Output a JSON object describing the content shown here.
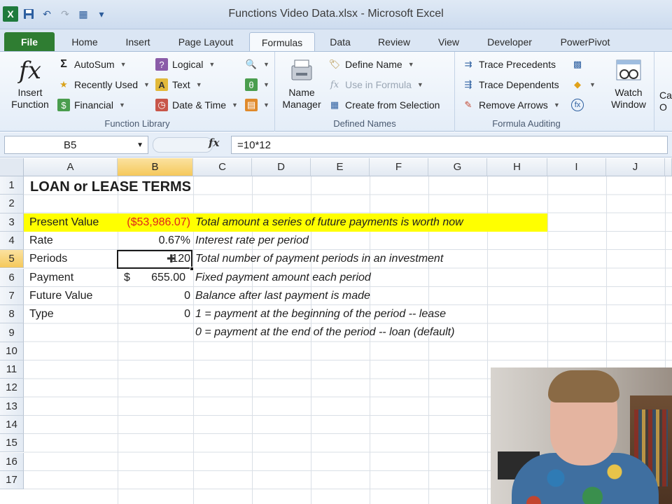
{
  "window": {
    "title": "Functions Video Data.xlsx - Microsoft Excel"
  },
  "quick_access": [
    {
      "icon": "excel-logo-icon",
      "glyph": "X"
    },
    {
      "icon": "save-icon",
      "glyph": "💾"
    },
    {
      "icon": "undo-icon",
      "glyph": "↶"
    },
    {
      "icon": "redo-icon",
      "glyph": "↷"
    },
    {
      "icon": "form-icon",
      "glyph": "▦"
    },
    {
      "icon": "customize-qat-icon",
      "glyph": "▾"
    }
  ],
  "tabs": [
    "File",
    "Home",
    "Insert",
    "Page Layout",
    "Formulas",
    "Data",
    "Review",
    "View",
    "Developer",
    "PowerPivot"
  ],
  "active_tab": "Formulas",
  "ribbon": {
    "function_library": {
      "label": "Function Library",
      "insert_function": {
        "line1": "Insert",
        "line2": "Function"
      },
      "autosum": "AutoSum",
      "recently_used": "Recently Used",
      "financial": "Financial",
      "logical": "Logical",
      "text": "Text",
      "date_time": "Date & Time"
    },
    "defined_names": {
      "label": "Defined Names",
      "name_manager": {
        "line1": "Name",
        "line2": "Manager"
      },
      "define_name": "Define Name",
      "use_in_formula": "Use in Formula",
      "create_from_selection": "Create from Selection"
    },
    "formula_auditing": {
      "label": "Formula Auditing",
      "trace_precedents": "Trace Precedents",
      "trace_dependents": "Trace Dependents",
      "remove_arrows": "Remove Arrows",
      "watch_window": {
        "line1": "Watch",
        "line2": "Window"
      },
      "calc_partial": {
        "line1": "Ca",
        "line2": "O"
      }
    }
  },
  "formula_bar": {
    "name_box": "B5",
    "fx": "fx",
    "formula": "=10*12"
  },
  "columns": [
    "A",
    "B",
    "C",
    "D",
    "E",
    "F",
    "G",
    "H",
    "I",
    "J"
  ],
  "selected_column": "B",
  "rows": [
    "1",
    "2",
    "3",
    "4",
    "5",
    "6",
    "7",
    "8",
    "9",
    "10",
    "11",
    "12",
    "13",
    "14",
    "15",
    "16",
    "17"
  ],
  "selected_row": "5",
  "sheet": {
    "title": "LOAN or LEASE TERMS",
    "rows": [
      {
        "label": "Present Value",
        "value": "($53,986.07)",
        "note": "Total amount a series of future payments is worth now"
      },
      {
        "label": "Rate",
        "value": "0.67%",
        "note": "Interest rate per period"
      },
      {
        "label": "Periods",
        "value": "120",
        "note": "Total number of payment periods in an investment"
      },
      {
        "label": "Payment",
        "currency": "$",
        "value": "655.00",
        "note": "Fixed payment amount each period"
      },
      {
        "label": "Future Value",
        "value": "0",
        "note": "Balance after last payment is made"
      },
      {
        "label": "Type",
        "value": "0",
        "note": "1 = payment at the beginning of the period -- lease"
      }
    ],
    "extra_note": "0 = payment at the end of the period -- loan (default)"
  },
  "colors": {
    "highlight": "#ffff00",
    "negative": "#e0241b",
    "file_tab": "#2f7d32"
  }
}
